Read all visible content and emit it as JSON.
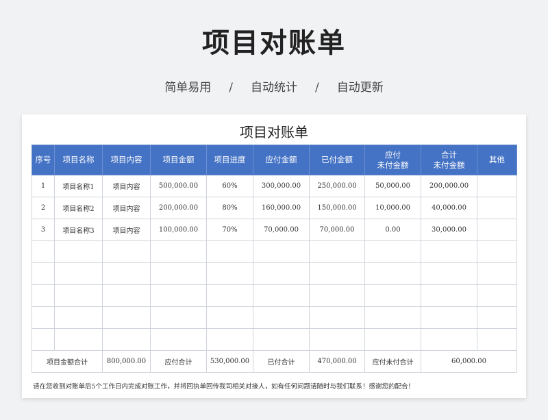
{
  "page": {
    "title": "项目对账单",
    "subtitle_items": [
      "简单易用",
      "自动统计",
      "自动更新"
    ],
    "separator": "/"
  },
  "sheet": {
    "title": "项目对账单",
    "headers": [
      [
        "序号"
      ],
      [
        "项目名称"
      ],
      [
        "项目内容"
      ],
      [
        "项目金额"
      ],
      [
        "项目进度"
      ],
      [
        "应付金额"
      ],
      [
        "已付金额"
      ],
      [
        "应付",
        "未付金额"
      ],
      [
        "合计",
        "未付金额"
      ],
      [
        "其他"
      ]
    ],
    "rows": [
      [
        "1",
        "项目名称1",
        "项目内容",
        "500,000.00",
        "60%",
        "300,000.00",
        "250,000.00",
        "50,000.00",
        "200,000.00",
        ""
      ],
      [
        "2",
        "项目名称2",
        "项目内容",
        "200,000.00",
        "80%",
        "160,000.00",
        "150,000.00",
        "10,000.00",
        "40,000.00",
        ""
      ],
      [
        "3",
        "项目名称3",
        "项目内容",
        "100,000.00",
        "70%",
        "70,000.00",
        "70,000.00",
        "0.00",
        "30,000.00",
        ""
      ],
      [
        "",
        "",
        "",
        "",
        "",
        "",
        "",
        "",
        "",
        ""
      ],
      [
        "",
        "",
        "",
        "",
        "",
        "",
        "",
        "",
        "",
        ""
      ],
      [
        "",
        "",
        "",
        "",
        "",
        "",
        "",
        "",
        "",
        ""
      ],
      [
        "",
        "",
        "",
        "",
        "",
        "",
        "",
        "",
        "",
        ""
      ],
      [
        "",
        "",
        "",
        "",
        "",
        "",
        "",
        "",
        "",
        ""
      ]
    ],
    "footer": {
      "total_amount_label": "项目金额合计",
      "total_amount_value": "800,000.00",
      "payable_label": "应付合计",
      "payable_value": "530,000.00",
      "paid_label": "已付合计",
      "paid_value": "470,000.00",
      "unpaid_label": "应付未付合计",
      "unpaid_value": "60,000.00"
    },
    "note": "请在您收到对账单后5个工作日内完成对账工作，并将回执单回传我司相关对接人，如有任何问题请随时与我们联系！感谢您的配合！"
  },
  "colors": {
    "header_bg": "#4472c4",
    "page_bg": "#f1f2f4",
    "grid_line": "#cfd3db"
  }
}
